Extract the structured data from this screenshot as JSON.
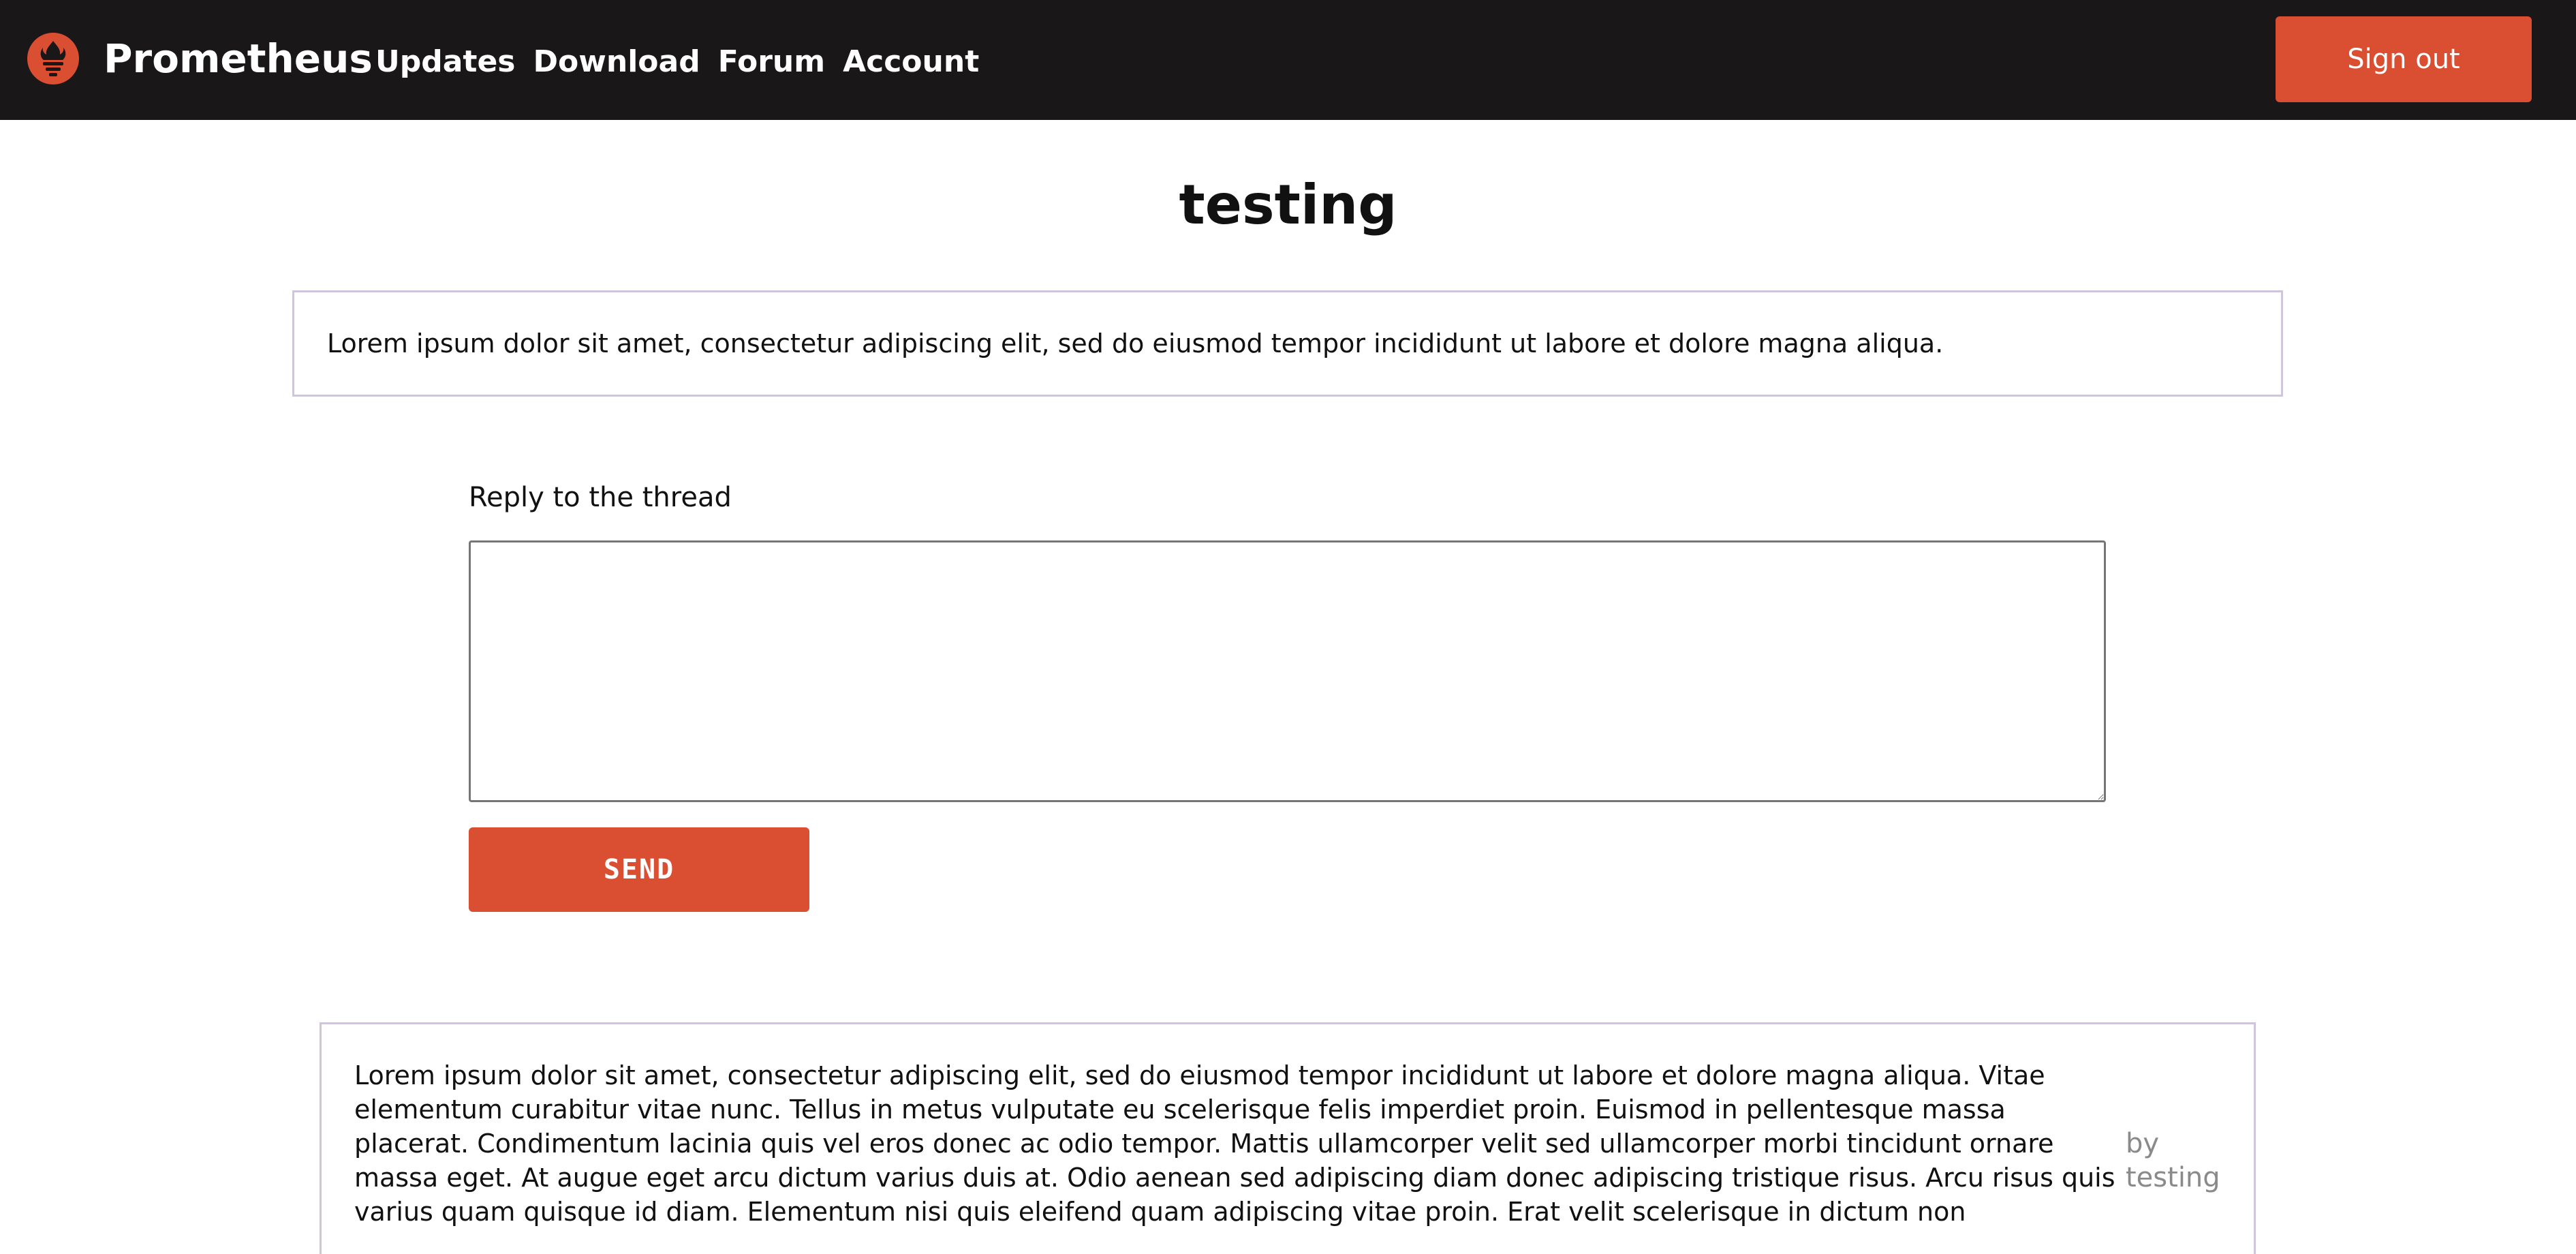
{
  "header": {
    "brand": "Prometheus",
    "nav": [
      "Updates",
      "Download",
      "Forum",
      "Account"
    ],
    "signout_label": "Sign out",
    "logo_icon": "torch-flame-icon",
    "accent_color": "#da4e32"
  },
  "thread": {
    "title": "testing",
    "body": "Lorem ipsum dolor sit amet, consectetur adipiscing elit, sed do eiusmod tempor incididunt ut labore et dolore magna aliqua."
  },
  "reply_form": {
    "label": "Reply to the thread",
    "value": "",
    "placeholder": "",
    "send_label": "SEND"
  },
  "posts": [
    {
      "text": "Lorem ipsum dolor sit amet, consectetur adipiscing elit, sed do eiusmod tempor incididunt ut labore et dolore magna aliqua. Vitae elementum curabitur vitae nunc. Tellus in metus vulputate eu scelerisque felis imperdiet proin. Euismod in pellentesque massa placerat. Condimentum lacinia quis vel eros donec ac odio tempor. Mattis ullamcorper velit sed ullamcorper morbi tincidunt ornare massa eget. At augue eget arcu dictum varius duis at. Odio aenean sed adipiscing diam donec adipiscing tristique risus. Arcu risus quis varius quam quisque id diam. Elementum nisi quis eleifend quam adipiscing vitae proin. Erat velit scelerisque in dictum non",
      "author": "by testing"
    }
  ]
}
